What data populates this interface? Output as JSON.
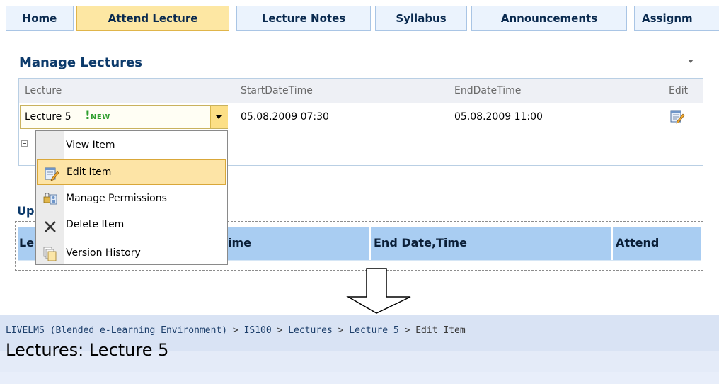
{
  "tabs": [
    {
      "label": "Home",
      "active": false
    },
    {
      "label": "Attend Lecture",
      "active": true
    },
    {
      "label": "Lecture Notes",
      "active": false
    },
    {
      "label": "Syllabus",
      "active": false
    },
    {
      "label": "Announcements",
      "active": false
    },
    {
      "label": "Assignm",
      "active": false
    }
  ],
  "manage_lectures": {
    "title": "Manage Lectures",
    "columns": {
      "lecture": "Lecture",
      "start": "StartDateTime",
      "end": "EndDateTime",
      "edit": "Edit"
    },
    "row": {
      "title": "Lecture 5",
      "new_tag": "NEW",
      "new_mark": "!",
      "start": "05.08.2009 07:30",
      "end": "05.08.2009 11:00"
    }
  },
  "context_menu": {
    "items": [
      {
        "label": "View Item",
        "icon": "none"
      },
      {
        "label": "Edit Item",
        "icon": "edit-icon",
        "highlighted": true
      },
      {
        "label": "Manage Permissions",
        "icon": "permissions-icon"
      },
      {
        "label": "Delete Item",
        "icon": "delete-icon"
      },
      {
        "label": "Version History",
        "icon": "version-history-icon"
      }
    ]
  },
  "upcoming": {
    "title_visible": "Up",
    "title_tail_visible": "Le",
    "columns": {
      "start_partial": "ime",
      "end": "End Date,Time",
      "attend": "Attend"
    }
  },
  "edit_page": {
    "breadcrumb": [
      "LIVELMS (Blended e-Learning Environment)",
      "IS100",
      "Lectures",
      "Lecture 5",
      "Edit Item"
    ],
    "separator": ">",
    "title": "Lectures: Lecture 5"
  },
  "colors": {
    "tab_bg": "#ebf3fd",
    "tab_active_bg": "#fde7a3",
    "title_blue": "#0c3a6b",
    "menu_highlight": "#fde4a6",
    "header_blue": "#a9cdf2",
    "new_green": "#2e9e2e"
  }
}
